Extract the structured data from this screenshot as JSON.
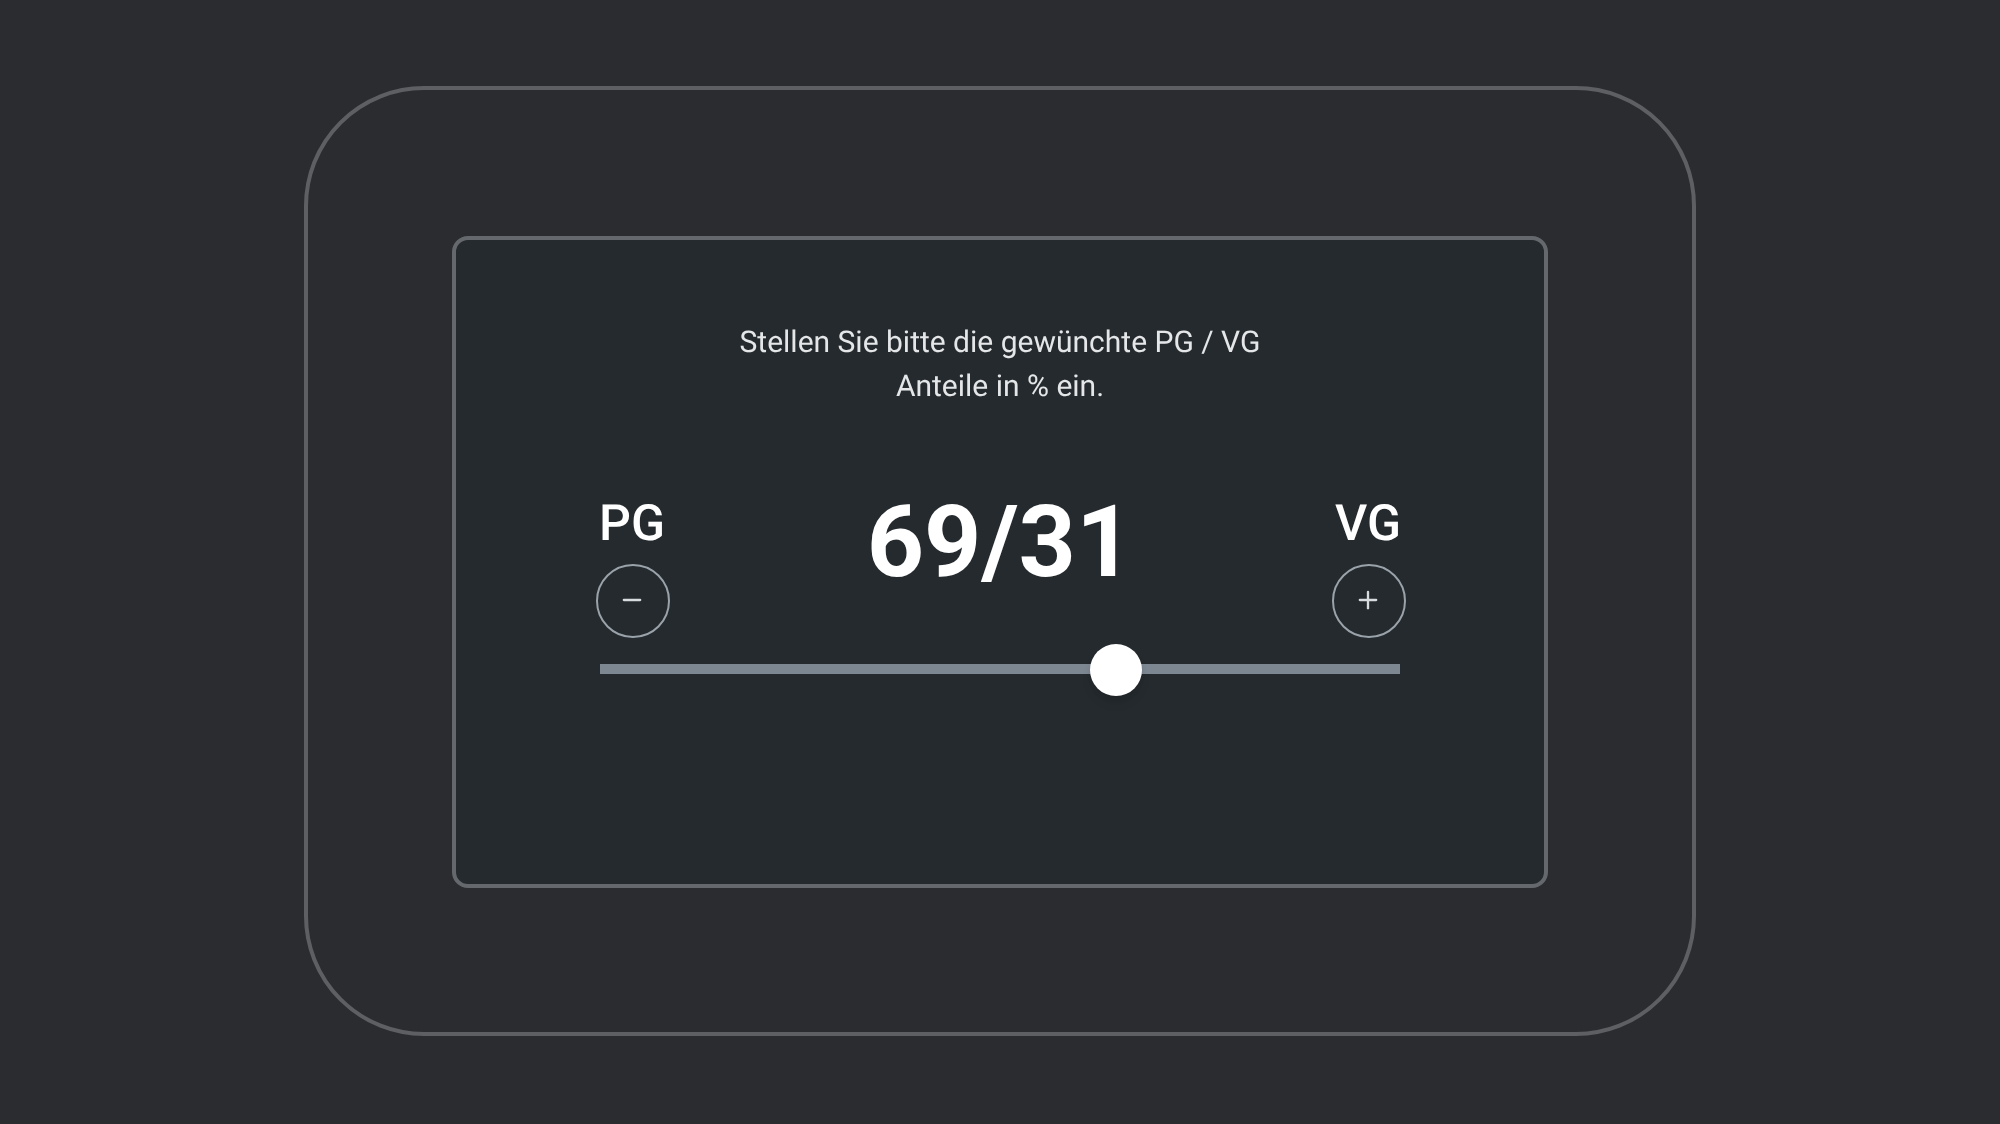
{
  "prompt": "Stellen Sie bitte die gewünchte PG / VG\nAnteile in % ein.",
  "left_label": "PG",
  "ratio": "69/31",
  "right_label": "VG",
  "slider": {
    "level": 0.645
  }
}
